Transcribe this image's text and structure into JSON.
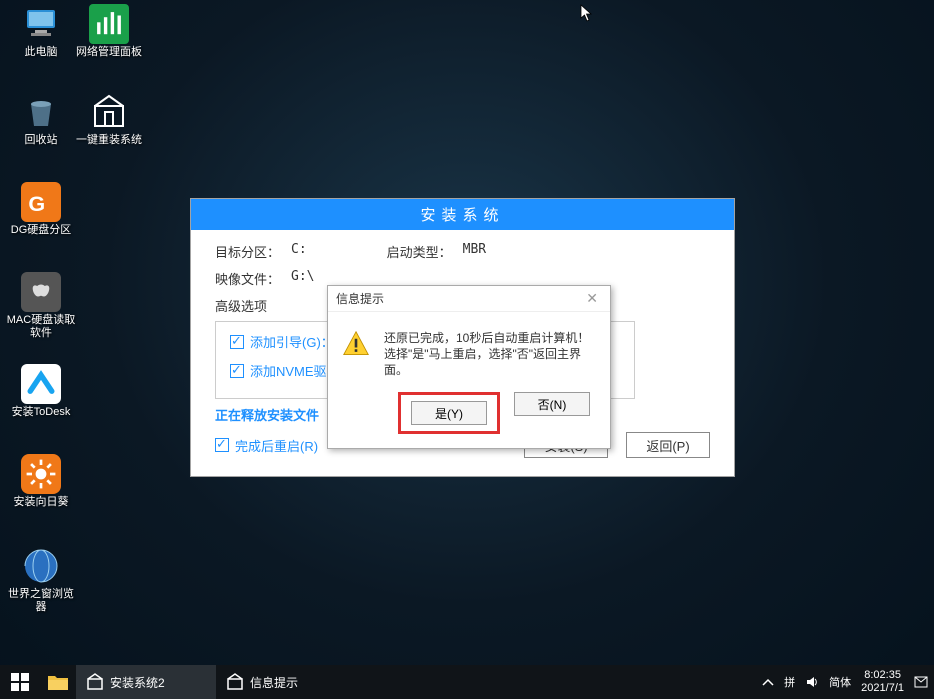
{
  "desktop_icons": {
    "this_pc": "此电脑",
    "network_panel": "网络管理面板",
    "recycle_bin": "回收站",
    "one_click_reinstall": "一键重装系统",
    "dg_partition": "DG硬盘分区",
    "mac_hd_reader": "MAC硬盘读取软件",
    "install_todesk": "安装ToDesk",
    "install_sunflower": "安装向日葵",
    "world_browser": "世界之窗浏览器"
  },
  "installer": {
    "title": "安装系统",
    "target_label": "目标分区：",
    "target_value": "C:",
    "boot_label": "启动类型：",
    "boot_value": "MBR",
    "image_label": "映像文件：",
    "image_value": "G:\\",
    "advanced_label": "高级选项",
    "opt_add_boot": "添加引导(G)：",
    "opt_add_nvme": "添加NVME驱",
    "progress_text": "正在释放安装文件",
    "opt_restart_after": "完成后重启(R)",
    "btn_install": "安装(S)",
    "btn_back": "返回(P)"
  },
  "modal": {
    "title": "信息提示",
    "msg_line1": "还原已完成，10秒后自动重启计算机！",
    "msg_line2": "选择\"是\"马上重启，选择\"否\"返回主界面。",
    "btn_yes": "是(Y)",
    "btn_no": "否(N)"
  },
  "taskbar": {
    "task1": "安装系统2",
    "task2": "信息提示",
    "ime_pinyin": "拼",
    "ime_simplified": "简体",
    "time": "8:02:35",
    "date": "2021/7/1"
  }
}
